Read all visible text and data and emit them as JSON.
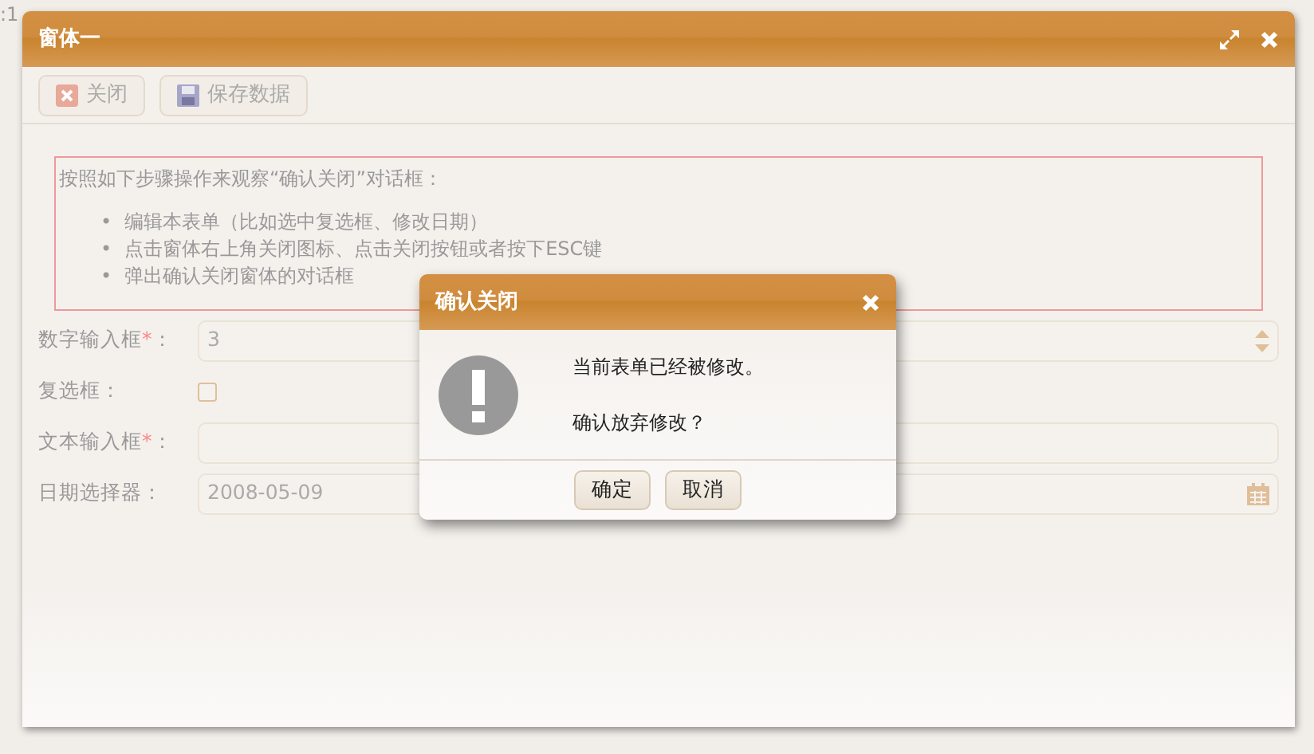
{
  "background_text": ":1",
  "window": {
    "title": "窗体一"
  },
  "toolbar": [
    {
      "kind": "close",
      "label": "关闭"
    },
    {
      "kind": "save",
      "label": "保存数据"
    }
  ],
  "info": {
    "bullet": "•",
    "intro": "按照如下步骤操作来观察“确认关闭”对话框：",
    "steps": [
      "编辑本表单（比如选中复选框、修改日期）",
      "点击窗体右上角关闭图标、点击关闭按钮或者按下ESC键",
      "弹出确认关闭窗体的对话框"
    ]
  },
  "fields": [
    {
      "kind": "number",
      "label": "数字输入框",
      "required_mark": "*",
      "suffix": "：",
      "value": "3"
    },
    {
      "kind": "checkbox",
      "label": "复选框",
      "suffix": "：",
      "checked": false
    },
    {
      "kind": "text",
      "label": "文本输入框",
      "required_mark": "*",
      "suffix": "："
    },
    {
      "kind": "date",
      "label": "日期选择器",
      "suffix": "：",
      "value": "2008-05-09"
    }
  ],
  "dialog": {
    "title": "确认关闭",
    "lines": [
      "当前表单已经被修改。",
      "确认放弃修改？"
    ],
    "buttons": [
      "确定",
      "取消"
    ]
  }
}
